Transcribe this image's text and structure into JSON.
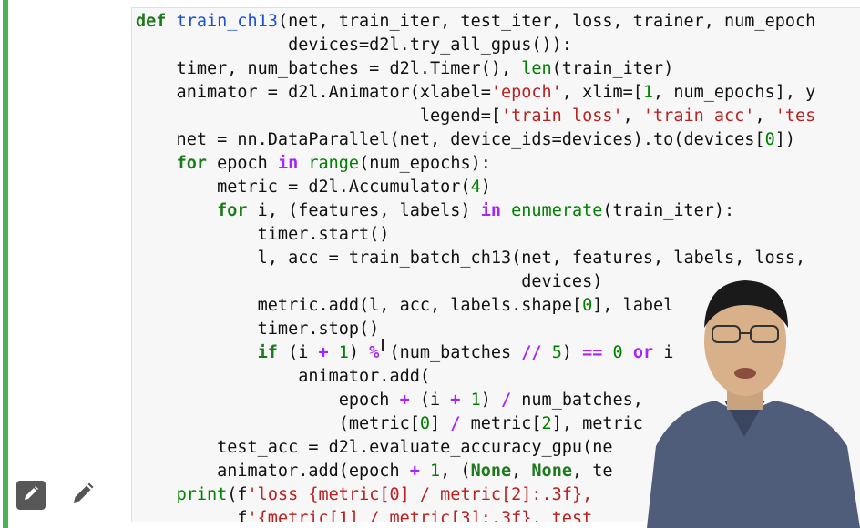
{
  "sidebar": {
    "edit_icon_dark": "pencil-icon",
    "edit_icon_plain": "pencil-icon"
  },
  "code": {
    "lines": [
      "def train_ch13(net, train_iter, test_iter, loss, trainer, num_epoch",
      "               devices=d2l.try_all_gpus()):",
      "    timer, num_batches = d2l.Timer(), len(train_iter)",
      "    animator = d2l.Animator(xlabel='epoch', xlim=[1, num_epochs], y",
      "                            legend=['train loss', 'train acc', 'tes",
      "    net = nn.DataParallel(net, device_ids=devices).to(devices[0])",
      "    for epoch in range(num_epochs):",
      "        metric = d2l.Accumulator(4)",
      "        for i, (features, labels) in enumerate(train_iter):",
      "            timer.start()",
      "            l, acc = train_batch_ch13(net, features, labels, loss,",
      "                                      devices)",
      "            metric.add(l, acc, labels.shape[0], label",
      "            timer.stop()",
      "            if (i + 1) % (num_batches // 5) == 0 or i",
      "                animator.add(",
      "                    epoch + (i + 1) / num_batches,",
      "                    (metric[0] / metric[2], metric",
      "        test_acc = d2l.evaluate_accuracy_gpu(ne",
      "        animator.add(epoch + 1, (None, None, te",
      "    print(f'loss {metric[0] / metric[2]:.3f},",
      "          f'{metric[1] / metric[3]:.3f}, test"
    ]
  },
  "colors": {
    "accent_bar": "#46b454",
    "keyword": "#1c7a1c",
    "function": "#1a4fd6",
    "string": "#ba2121",
    "number": "#008000",
    "operator": "#aa22ff",
    "cell_background": "#f7f7f7"
  }
}
